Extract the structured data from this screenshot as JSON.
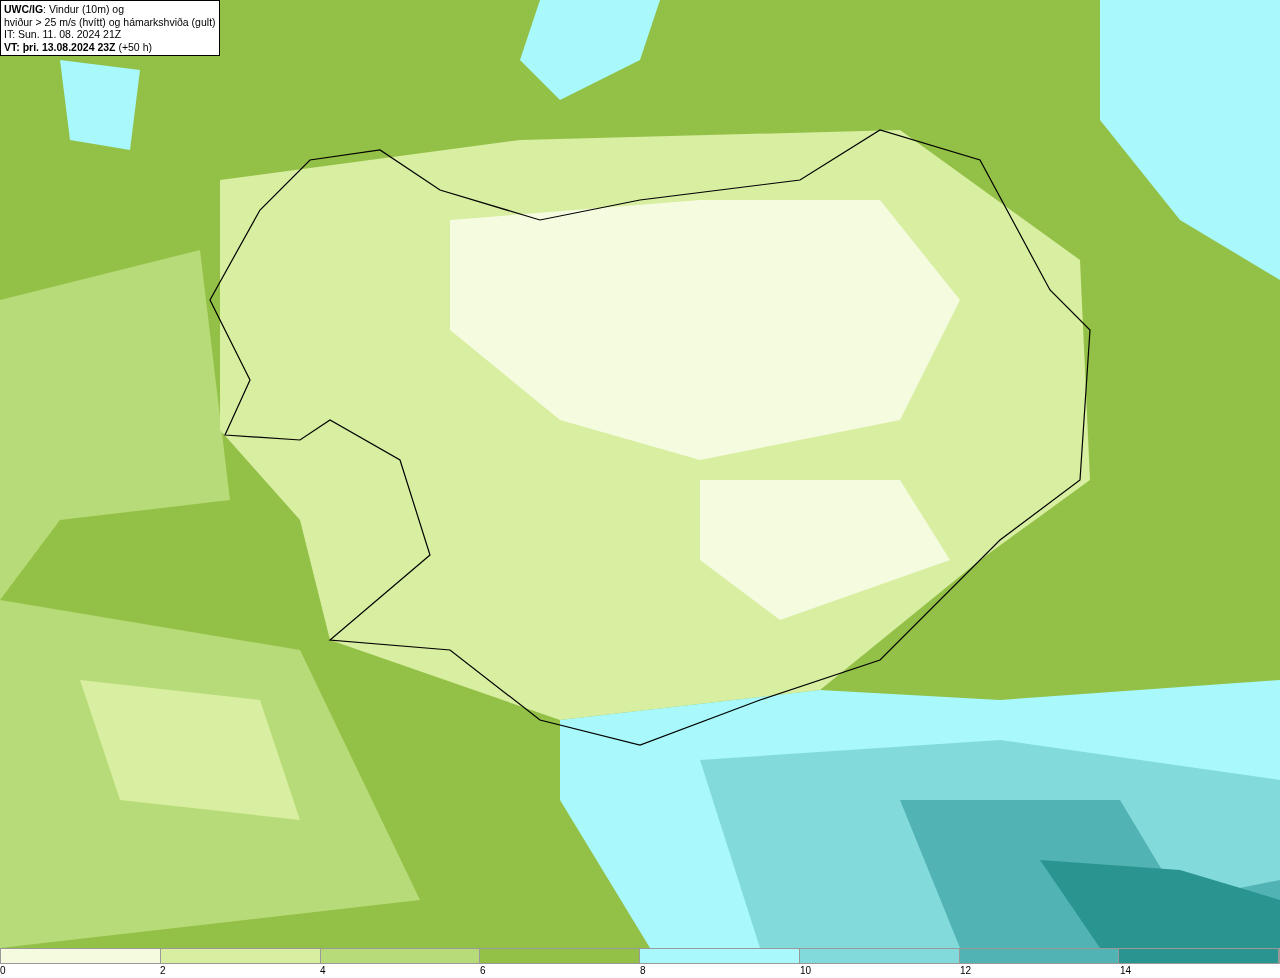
{
  "title_box": {
    "lines": [
      "**UWC/IG**: Vindur (10m) og",
      "hviður > 25 m/s (hvítt) og hámarkshviða (gult)",
      "IT: Sun. 11. 08. 2024 21Z",
      "**VT: þri. 13.08.2024 23Z** (+50 h)"
    ]
  },
  "legend": {
    "bins": [
      {
        "color": "#f4fbdf"
      },
      {
        "color": "#d8eea0"
      },
      {
        "color": "#b7db78"
      },
      {
        "color": "#93c046"
      },
      {
        "color": "#a9f8fb"
      },
      {
        "color": "#82dadb"
      },
      {
        "color": "#52b3b4"
      },
      {
        "color": "#2a9590"
      }
    ],
    "ticks": [
      "0",
      "2",
      "4",
      "6",
      "8",
      "10",
      "12",
      "14"
    ]
  }
}
